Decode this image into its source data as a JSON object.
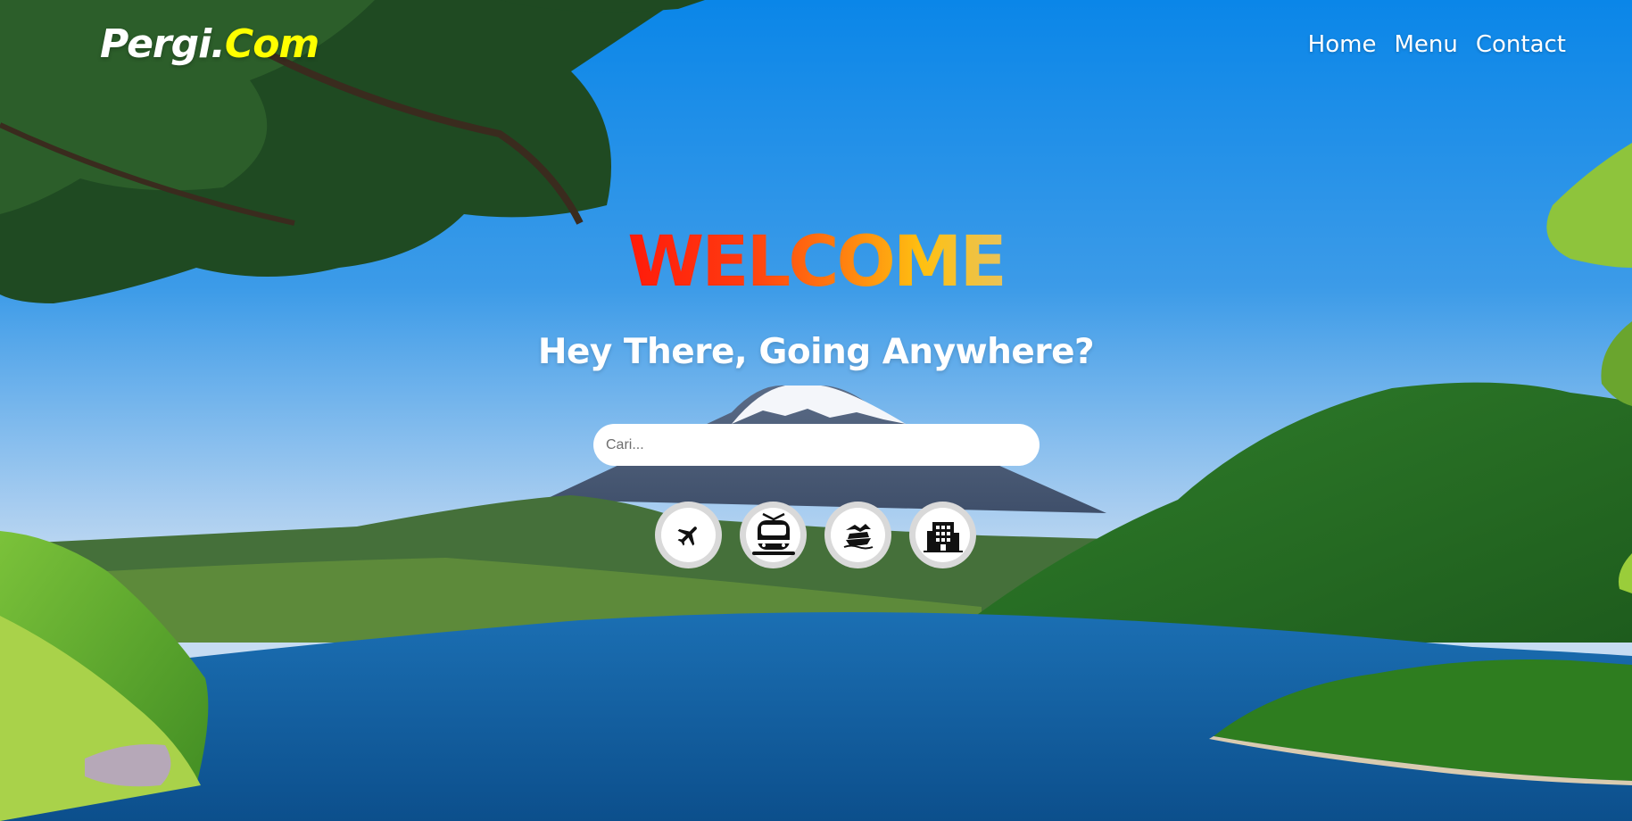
{
  "header": {
    "logo_part1": "Pergi.",
    "logo_part2": "Com",
    "nav": [
      {
        "label": "Home"
      },
      {
        "label": "Menu"
      },
      {
        "label": "Contact"
      }
    ]
  },
  "hero": {
    "welcome": "WELCOME",
    "tagline": "Hey There, Going Anywhere?",
    "search": {
      "placeholder": "Cari...",
      "value": ""
    },
    "categories": [
      {
        "icon": "plane-icon"
      },
      {
        "icon": "train-icon"
      },
      {
        "icon": "ship-icon"
      },
      {
        "icon": "hotel-icon"
      }
    ]
  },
  "colors": {
    "logo_accent": "#ffff00",
    "text": "#ffffff",
    "welcome_gradient": [
      "#ff1a0a",
      "#ff7a10",
      "#ffc011",
      "#e8c35a"
    ]
  }
}
